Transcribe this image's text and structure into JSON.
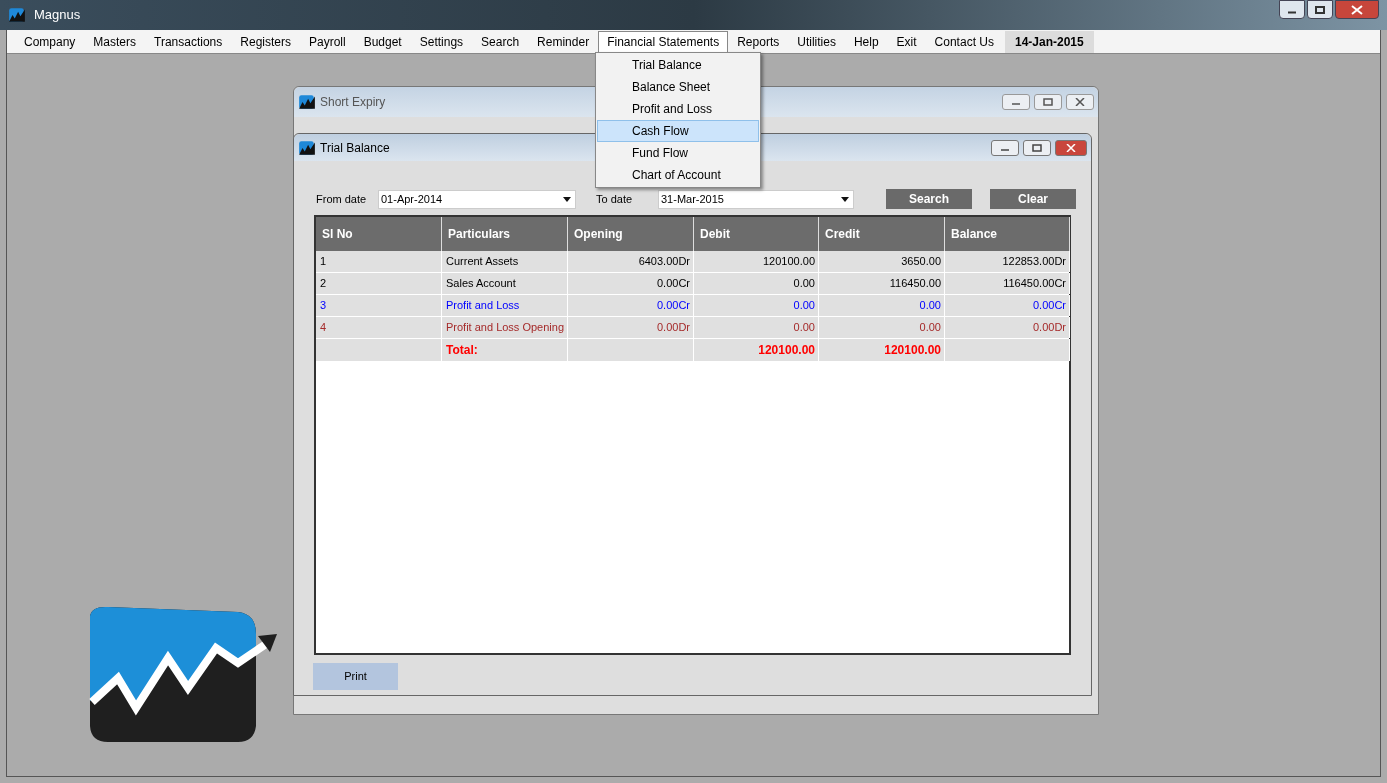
{
  "window": {
    "title": "Magnus"
  },
  "menu": [
    {
      "label": "Company",
      "selected": false
    },
    {
      "label": "Masters",
      "selected": false
    },
    {
      "label": "Transactions",
      "selected": false
    },
    {
      "label": "Registers",
      "selected": false
    },
    {
      "label": "Payroll",
      "selected": false
    },
    {
      "label": "Budget",
      "selected": false
    },
    {
      "label": "Settings",
      "selected": false
    },
    {
      "label": "Search",
      "selected": false
    },
    {
      "label": "Reminder",
      "selected": false
    },
    {
      "label": "Financial Statements",
      "selected": true
    },
    {
      "label": "Reports",
      "selected": false
    },
    {
      "label": "Utilities",
      "selected": false
    },
    {
      "label": "Help",
      "selected": false
    },
    {
      "label": "Exit",
      "selected": false
    },
    {
      "label": "Contact Us",
      "selected": false
    }
  ],
  "date_badge": "14-Jan-2015",
  "dropdown": [
    {
      "label": "Trial Balance",
      "selected": false
    },
    {
      "label": "Balance Sheet",
      "selected": false
    },
    {
      "label": "Profit and Loss",
      "selected": false
    },
    {
      "label": "Cash Flow",
      "selected": true
    },
    {
      "label": "Fund Flow",
      "selected": false
    },
    {
      "label": "Chart of Account",
      "selected": false
    }
  ],
  "back_window": {
    "title": "Short Expiry"
  },
  "trial_balance": {
    "title": "Trial Balance",
    "from_date": {
      "label": "From date",
      "value": "01-Apr-2014"
    },
    "to_date": {
      "label": "To date",
      "value": "31-Mar-2015"
    },
    "buttons": [
      "Search",
      "Clear"
    ],
    "table": {
      "columns": [
        "Sl No",
        "Particulars",
        "Opening",
        "Debit",
        "Credit",
        "Balance"
      ],
      "rows": [
        {
          "sl_no": "1",
          "particulars": "Current Assets",
          "opening": "6403.00Dr",
          "debit": "120100.00",
          "credit": "3650.00",
          "balance": "122853.00Dr",
          "color": "#000000"
        },
        {
          "sl_no": "2",
          "particulars": "Sales Account",
          "opening": "0.00Cr",
          "debit": "0.00",
          "credit": "116450.00",
          "balance": "116450.00Cr",
          "color": "#000000"
        },
        {
          "sl_no": "3",
          "particulars": "Profit and Loss",
          "opening": "0.00Cr",
          "debit": "0.00",
          "credit": "0.00",
          "balance": "0.00Cr",
          "color": "#0000ff"
        },
        {
          "sl_no": "4",
          "particulars": "Profit and Loss Opening",
          "opening": "0.00Dr",
          "debit": "0.00",
          "credit": "0.00",
          "balance": "0.00Dr",
          "color": "#a52a2a"
        }
      ],
      "total": {
        "label": "Total:",
        "debit": "120100.00",
        "credit": "120100.00"
      }
    },
    "print_button": "Print"
  }
}
